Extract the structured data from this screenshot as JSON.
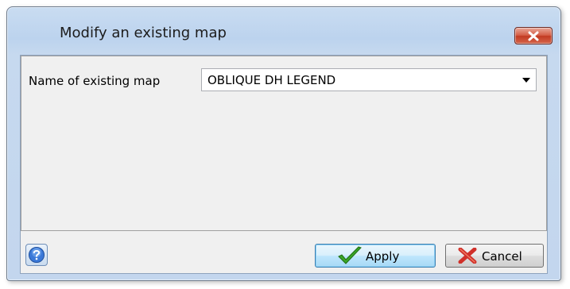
{
  "window": {
    "title": "Modify an existing map",
    "close_icon": "close-icon"
  },
  "form": {
    "map_name_label": "Name of existing map",
    "map_name_value": "OBLIQUE DH LEGEND",
    "dropdown_icon": "chevron-down-icon"
  },
  "buttons": {
    "help_icon": "help-icon",
    "apply_label": "Apply",
    "apply_icon": "checkmark-icon",
    "cancel_label": "Cancel",
    "cancel_icon": "x-mark-icon"
  },
  "colors": {
    "titlebar": "#bcd3ee",
    "close_button": "#c23a22",
    "apply_check": "#3aa526",
    "cancel_x": "#d0302a",
    "help_circle": "#2f6fd0"
  }
}
